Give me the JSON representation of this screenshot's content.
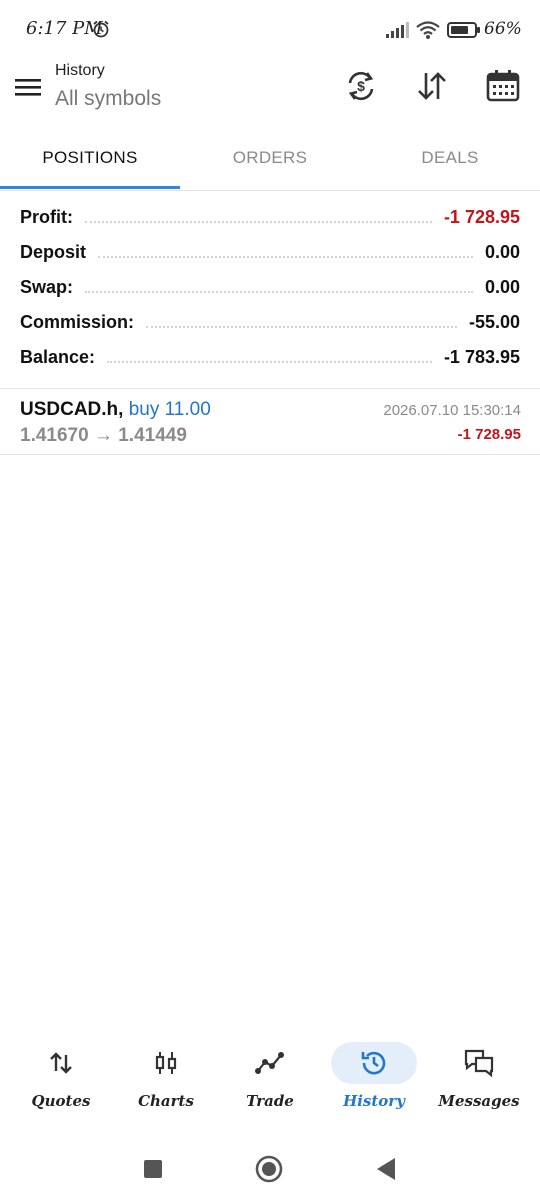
{
  "status_bar": {
    "time": "6:17 PM",
    "battery": "66%"
  },
  "toolbar": {
    "title": "History",
    "subtitle": "All symbols"
  },
  "tabs": [
    {
      "label": "POSITIONS",
      "active": true
    },
    {
      "label": "ORDERS",
      "active": false
    },
    {
      "label": "DEALS",
      "active": false
    }
  ],
  "summary": {
    "profit": {
      "label": "Profit:",
      "value": "-1 728.95"
    },
    "deposit": {
      "label": "Deposit",
      "value": "0.00"
    },
    "swap": {
      "label": "Swap:",
      "value": "0.00"
    },
    "commission": {
      "label": "Commission:",
      "value": "-55.00"
    },
    "balance": {
      "label": "Balance:",
      "value": "-1 783.95"
    }
  },
  "positions": [
    {
      "symbol": "USDCAD.h,",
      "side": "buy 11.00",
      "prices": "1.41670 → 1.41449",
      "time": "2026.07.10 15:30:14",
      "profit": "-1 728.95"
    }
  ],
  "bottom_nav": [
    {
      "label": "Quotes",
      "icon": "quotes-icon",
      "active": false
    },
    {
      "label": "Charts",
      "icon": "charts-icon",
      "active": false
    },
    {
      "label": "Trade",
      "icon": "trade-icon",
      "active": false
    },
    {
      "label": "History",
      "icon": "history-icon",
      "active": true
    },
    {
      "label": "Messages",
      "icon": "messages-icon",
      "active": false
    }
  ],
  "colors": {
    "accent": "#1f78c8",
    "negative": "#c2151b",
    "tab_indicator": "#2e86de"
  }
}
